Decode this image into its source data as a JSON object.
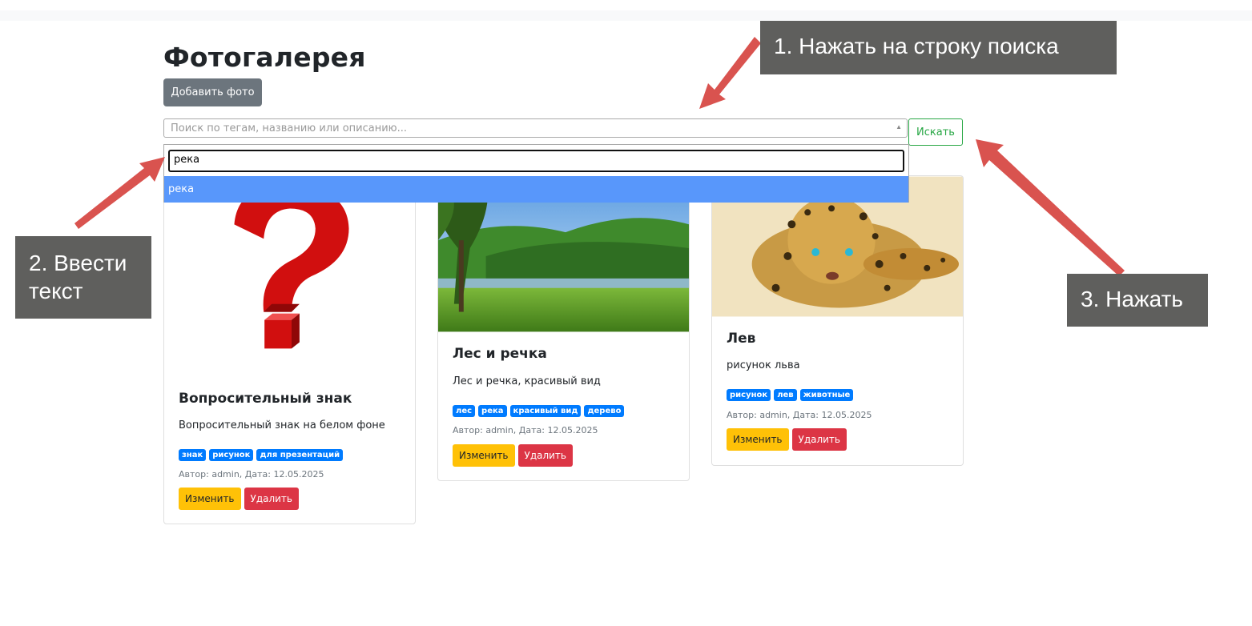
{
  "page": {
    "title": "Фотогалерея",
    "add_button": "Добавить фото"
  },
  "search": {
    "placeholder": "Поиск по тегам, названию или описанию...",
    "button": "Искать",
    "dropdown_input": "река",
    "dropdown_option": "река"
  },
  "cards": [
    {
      "title": "Вопросительный знак",
      "description": "Вопросительный знак на белом фоне",
      "tags": [
        "знак",
        "рисунок",
        "для презентаций"
      ],
      "meta": "Автор: admin, Дата: 12.05.2025",
      "edit": "Изменить",
      "delete": "Удалить"
    },
    {
      "title": "Лес и речка",
      "description": "Лес и речка, красивый вид",
      "tags": [
        "лес",
        "река",
        "красивый вид",
        "дерево"
      ],
      "meta": "Автор: admin, Дата: 12.05.2025",
      "edit": "Изменить",
      "delete": "Удалить"
    },
    {
      "title": "Лев",
      "description": "рисунок льва",
      "tags": [
        "рисунок",
        "лев",
        "животные"
      ],
      "meta": "Автор: admin, Дата: 12.05.2025",
      "edit": "Изменить",
      "delete": "Удалить"
    }
  ],
  "callouts": {
    "step1": "1. Нажать на строку поиска",
    "step2": "2. Ввести текст",
    "step3": "3. Нажать"
  },
  "colors": {
    "tag": "#007bff",
    "edit": "#ffc107",
    "delete": "#dc3545",
    "search_button": "#28a745",
    "dropdown_highlight": "#5897fb",
    "callout_bg": "#5f5f5d",
    "arrow": "#d9534f"
  }
}
